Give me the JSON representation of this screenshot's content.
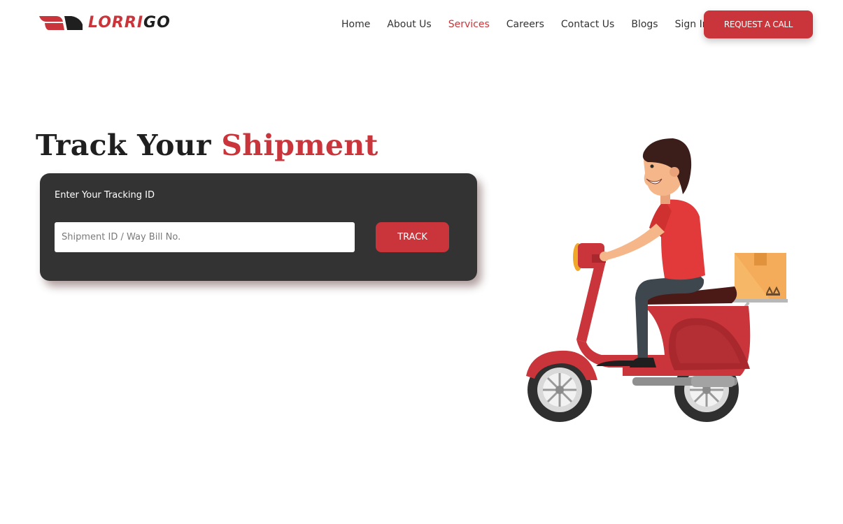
{
  "header": {
    "logo": {
      "part1": "LORRI",
      "part2": "GO"
    },
    "nav": [
      {
        "label": "Home",
        "active": false
      },
      {
        "label": "About Us",
        "active": false
      },
      {
        "label": "Services",
        "active": true
      },
      {
        "label": "Careers",
        "active": false
      },
      {
        "label": "Contact Us",
        "active": false
      },
      {
        "label": "Blogs",
        "active": false
      },
      {
        "label": "Sign In",
        "active": false
      }
    ],
    "cta_label": "REQUEST A CALL"
  },
  "hero": {
    "title_part1": "Track Your",
    "title_part2": "Shipment"
  },
  "tracking": {
    "label": "Enter Your Tracking ID",
    "input_value": "",
    "input_placeholder": "Shipment ID / Way Bill No.",
    "button_label": "TRACK"
  },
  "colors": {
    "accent": "#c9353a",
    "dark": "#333333",
    "text": "#1f1f1f"
  },
  "icons": [
    "brand-logo-icon",
    "delivery-scooter-illustration"
  ]
}
